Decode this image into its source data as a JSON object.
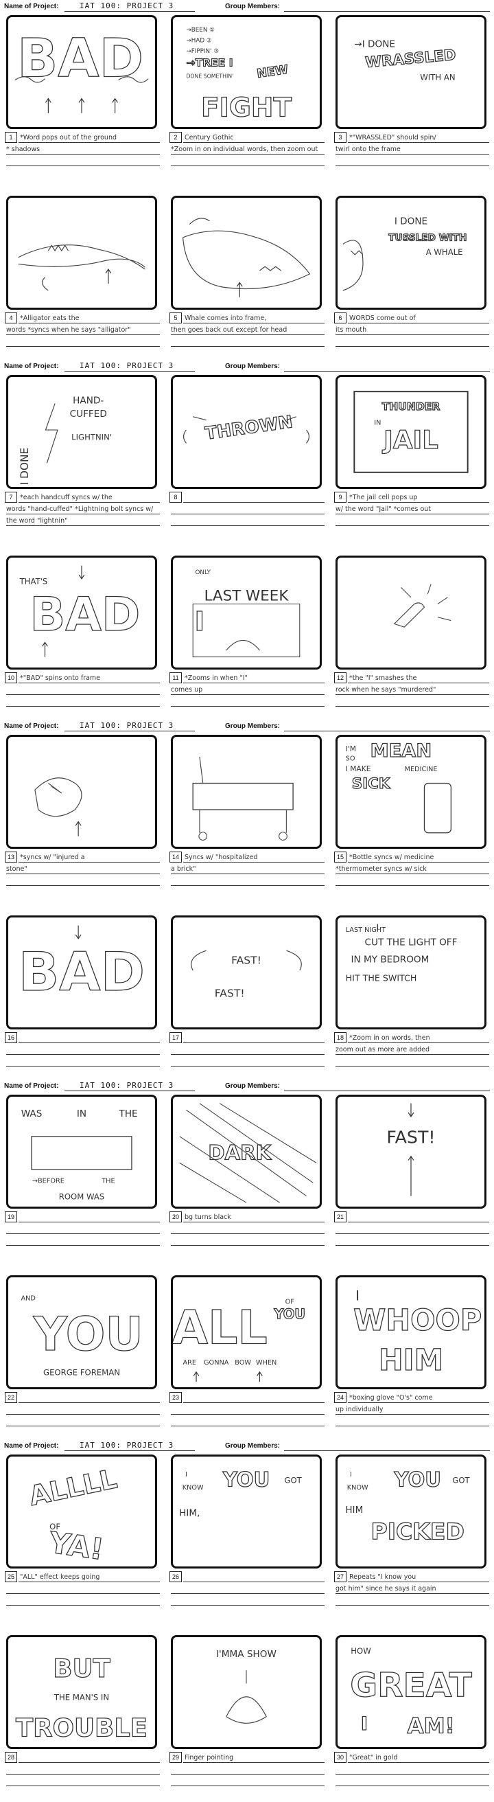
{
  "header": {
    "project_label": "Name of Project:",
    "project_value": "IAT 100: PROJECT 3",
    "members_label": "Group Members:"
  },
  "panels": [
    {
      "num": "1",
      "art": [
        "BAD"
      ],
      "caption": "*Word pops out of the ground",
      "caption2": "* shadows"
    },
    {
      "num": "2",
      "art": [
        "BEEN",
        "HAD",
        "FIPPIN'",
        "TREE",
        "DONE SOMETHIN'",
        "NEW",
        "FIGHT"
      ],
      "caption": "Century Gothic",
      "caption2": "*Zoom in on individual words, then zoom out"
    },
    {
      "num": "3",
      "art": [
        "I DONE",
        "WRASSLED",
        "WITH AN"
      ],
      "caption": "*\"WRASSLED\" should spin/",
      "caption2": "twirl onto the frame"
    },
    {
      "num": "4",
      "art": [],
      "caption": "*Alligator eats the",
      "caption2": "words *syncs when he says \"alligator\""
    },
    {
      "num": "5",
      "art": [],
      "caption": "Whale comes into frame,",
      "caption2": "then goes back out except for head"
    },
    {
      "num": "6",
      "art": [
        "I DONE",
        "TUSSLED WITH",
        "A WHALE"
      ],
      "caption": "WORDS come out of",
      "caption2": "its mouth"
    },
    {
      "num": "7",
      "art": [
        "I DONE",
        "HAND-",
        "CUFFED",
        "LIGHTNIN'"
      ],
      "caption": "*each handcuff syncs w/ the",
      "caption2": "words \"hand-cuffed\"  *Lightning bolt syncs w/ the word \"lightnin\""
    },
    {
      "num": "8",
      "art": [
        "THROWN"
      ],
      "caption": "",
      "caption2": ""
    },
    {
      "num": "9",
      "art": [
        "THUNDER",
        "IN",
        "JAIL"
      ],
      "caption": "*The jail cell pops up",
      "caption2": "w/ the word \"Jail\"  *comes out"
    },
    {
      "num": "10",
      "art": [
        "THAT'S",
        "BAD"
      ],
      "caption": "*\"BAD\" spins onto frame",
      "caption2": ""
    },
    {
      "num": "11",
      "art": [
        "ONLY",
        "LAST WEEK",
        "I"
      ],
      "caption": "*Zooms in when \"I\"",
      "caption2": "comes up"
    },
    {
      "num": "12",
      "art": [],
      "caption": "*the \"I\" smashes the",
      "caption2": "rock when he says \"murdered\""
    },
    {
      "num": "13",
      "art": [],
      "caption": "*syncs w/ \"injured a",
      "caption2": "stone\""
    },
    {
      "num": "14",
      "art": [],
      "caption": "Syncs w/ \"hospitalized",
      "caption2": "a brick\""
    },
    {
      "num": "15",
      "art": [
        "I'M",
        "SO",
        "MEAN",
        "I",
        "MAKE",
        "MEDICINE",
        "SICK"
      ],
      "caption": "*Bottle syncs w/ medicine",
      "caption2": "*thermometer syncs w/ sick"
    },
    {
      "num": "16",
      "art": [
        "BAD"
      ],
      "caption": "",
      "caption2": ""
    },
    {
      "num": "17",
      "art": [
        "FAST!",
        "FAST!"
      ],
      "caption": "",
      "caption2": ""
    },
    {
      "num": "18",
      "art": [
        "LAST NIGHT",
        "I",
        "CUT THE LIGHT OFF",
        "IN MY BEDROOM",
        "HIT THE SWITCH"
      ],
      "caption": "*Zoom in on words, then",
      "caption2": "zoom out as more are added"
    },
    {
      "num": "19",
      "art": [
        "WAS",
        "IN",
        "THE",
        "BEFORE",
        "THE",
        "ROOM WAS"
      ],
      "caption": "",
      "caption2": ""
    },
    {
      "num": "20",
      "art": [
        "DARK"
      ],
      "caption": "bg turns black",
      "caption2": ""
    },
    {
      "num": "21",
      "art": [
        "FAST!"
      ],
      "caption": "",
      "caption2": ""
    },
    {
      "num": "22",
      "art": [
        "AND",
        "YOU",
        "GEORGE FOREMAN"
      ],
      "caption": "",
      "caption2": ""
    },
    {
      "num": "23",
      "art": [
        "ALL",
        "OF",
        "YOU",
        "ARE",
        "GONNA",
        "BOW",
        "WHEN"
      ],
      "caption": "",
      "caption2": ""
    },
    {
      "num": "24",
      "art": [
        "I",
        "WHOOP",
        "HIM"
      ],
      "caption": "*boxing glove \"O's\" come",
      "caption2": "up individually"
    },
    {
      "num": "25",
      "art": [
        "ALLLL",
        "OF",
        "YA!"
      ],
      "caption": "\"ALL\" effect keeps going",
      "caption2": ""
    },
    {
      "num": "26",
      "art": [
        "I",
        "KNOW",
        "YOU",
        "GOT",
        "HIM,"
      ],
      "caption": "",
      "caption2": ""
    },
    {
      "num": "27",
      "art": [
        "I",
        "KNOW",
        "YOU",
        "GOT",
        "HIM",
        "PICKED"
      ],
      "caption": "Repeats \"I know you",
      "caption2": "got him\" since he says it again"
    },
    {
      "num": "28",
      "art": [
        "BUT",
        "THE MAN'S IN",
        "TROUBLE"
      ],
      "caption": "",
      "caption2": ""
    },
    {
      "num": "29",
      "art": [
        "I'MMA SHOW"
      ],
      "caption": "Finger pointing",
      "caption2": ""
    },
    {
      "num": "30",
      "art": [
        "HOW",
        "GREAT",
        "I",
        "AM!"
      ],
      "caption": "\"Great\" in gold",
      "caption2": ""
    }
  ]
}
